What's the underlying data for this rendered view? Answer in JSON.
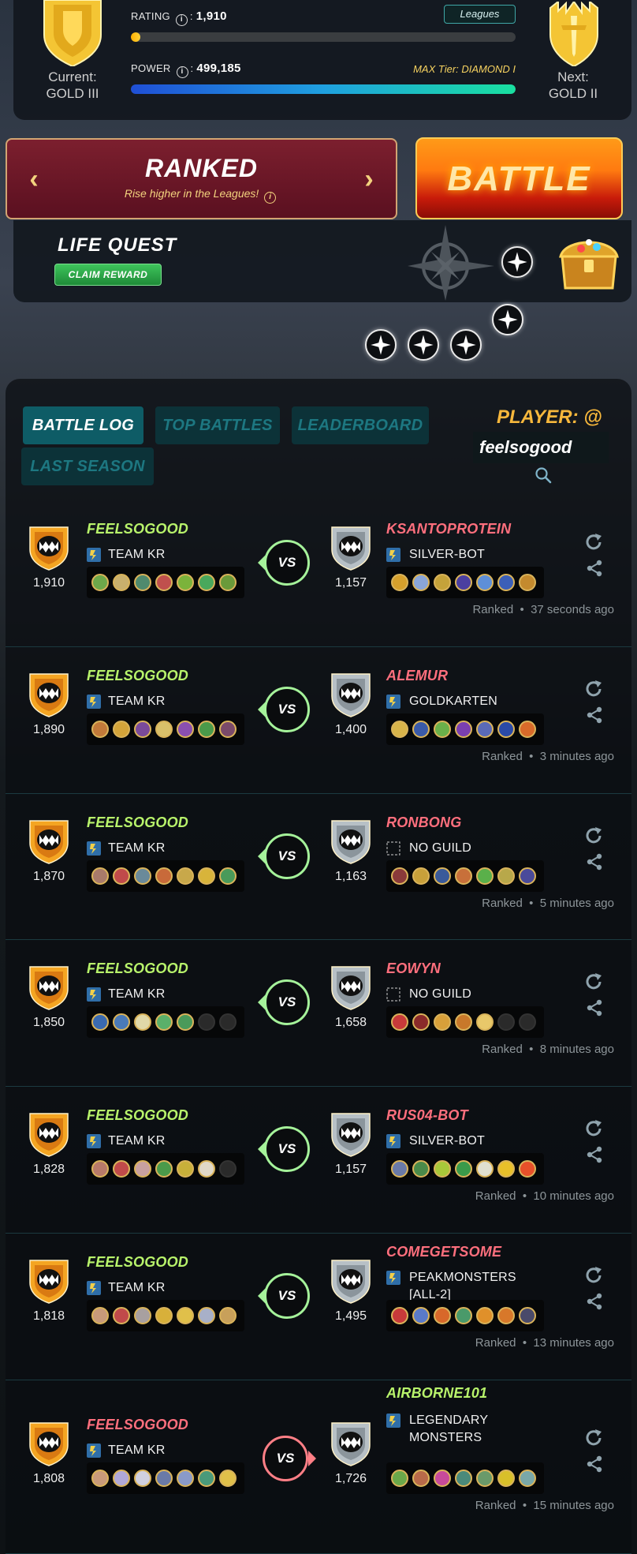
{
  "league": {
    "current_label": "Current:",
    "current_tier": "GOLD III",
    "next_label": "Next:",
    "next_tier": "GOLD II",
    "rating_label": "RATING",
    "rating_value": "1,910",
    "rating_progress": 0.025,
    "power_label": "POWER",
    "power_value": "499,185",
    "power_progress": 1.0,
    "leagues_button": "Leagues",
    "max_tier": "MAX Tier: DIAMOND I",
    "colors": {
      "gold": "#f4c534",
      "rating_bar": "#ffb000",
      "power_bar_start": "#1f4fd6",
      "power_bar_end": "#19e0a0"
    }
  },
  "ranked": {
    "title": "RANKED",
    "subtitle": "Rise higher in the Leagues!",
    "prev_icon": "chevron-left-icon",
    "next_icon": "chevron-right-icon"
  },
  "battle_button": "BATTLE",
  "quest": {
    "title": "LIFE QUEST",
    "claim_button": "CLAIM REWARD"
  },
  "tabs": [
    {
      "label": "BATTLE LOG",
      "active": true
    },
    {
      "label": "TOP BATTLES",
      "active": false
    },
    {
      "label": "LEADERBOARD",
      "active": false
    },
    {
      "label": "LAST SEASON",
      "active": false
    }
  ],
  "player": {
    "label": "PLAYER: @",
    "value": "feelsogood"
  },
  "colors": {
    "win_name": "#b8f36b",
    "loss_name": "#ff6f7d",
    "vs_win": "#a5f29a",
    "vs_loss": "#ff7f86"
  },
  "battles": [
    {
      "left": {
        "name": "FEELSOGOOD",
        "guild": "TEAM KR",
        "rating": "1,910",
        "won": true
      },
      "right": {
        "name": "KSANTOPROTEIN",
        "guild": "SILVER-BOT",
        "rating": "1,157",
        "won": false
      },
      "mode": "Ranked",
      "time": "37 seconds ago",
      "left_units": [
        "#6da84a",
        "#c9b06d",
        "#4f8a6e",
        "#c0504d",
        "#7bb33b",
        "#49a85c",
        "#6a9a3a"
      ],
      "right_units": [
        "#d6a02c",
        "#8aa6d8",
        "#c5a23a",
        "#4b3fa0",
        "#5e8fd8",
        "#3b5fb8",
        "#c48a2e"
      ]
    },
    {
      "left": {
        "name": "FEELSOGOOD",
        "guild": "TEAM KR",
        "rating": "1,890",
        "won": true
      },
      "right": {
        "name": "ALEMUR",
        "guild": "GOLDKARTEN",
        "rating": "1,400",
        "won": false
      },
      "mode": "Ranked",
      "time": "3 minutes ago",
      "left_units": [
        "#c27a3a",
        "#d4a43a",
        "#7a4a9a",
        "#d9c06a",
        "#8a4fb0",
        "#4a9a4a",
        "#7a4a6a"
      ],
      "right_units": [
        "#d8b44a",
        "#3a5aa8",
        "#6ab04a",
        "#7a3fb0",
        "#5a6ab8",
        "#2a4aa8",
        "#d86a2a"
      ]
    },
    {
      "left": {
        "name": "FEELSOGOOD",
        "guild": "TEAM KR",
        "rating": "1,870",
        "won": true
      },
      "right": {
        "name": "RONBONG",
        "guild": "NO GUILD",
        "rating": "1,163",
        "won": false
      },
      "mode": "Ranked",
      "time": "5 minutes ago",
      "left_units": [
        "#a87a6a",
        "#c04a4a",
        "#6a8a9a",
        "#c86a3a",
        "#c8a84a",
        "#d8b43a",
        "#4a9a5a"
      ],
      "right_units": [
        "#8a3a3a",
        "#c8a03a",
        "#3a5a9a",
        "#c8703a",
        "#5ab04a",
        "#b8a84a",
        "#4a4a9a"
      ]
    },
    {
      "left": {
        "name": "FEELSOGOOD",
        "guild": "TEAM KR",
        "rating": "1,850",
        "won": true
      },
      "right": {
        "name": "EOWYN",
        "guild": "NO GUILD",
        "rating": "1,658",
        "won": false
      },
      "mode": "Ranked",
      "time": "8 minutes ago",
      "left_units": [
        "#3a6ab0",
        "#4a7ab8",
        "#e0d8a8",
        "#5ab06a",
        "#4a9a5a",
        "",
        ""
      ],
      "right_units": [
        "#c83a3a",
        "#8a2a2a",
        "#d8a03a",
        "#c8782a",
        "#e8c86a",
        "",
        ""
      ]
    },
    {
      "left": {
        "name": "FEELSOGOOD",
        "guild": "TEAM KR",
        "rating": "1,828",
        "won": true
      },
      "right": {
        "name": "RUS04-BOT",
        "guild": "SILVER-BOT",
        "rating": "1,157",
        "won": false
      },
      "mode": "Ranked",
      "time": "10 minutes ago",
      "left_units": [
        "#b87a6a",
        "#c04a4a",
        "#c8a0a0",
        "#4a9a4a",
        "#c8b03a",
        "#e0d8c8",
        ""
      ],
      "right_units": [
        "#6a7aa8",
        "#4a8a4a",
        "#a8c83a",
        "#3a9a4a",
        "#e0e0d0",
        "#e8c02a",
        "#e8502a"
      ]
    },
    {
      "left": {
        "name": "FEELSOGOOD",
        "guild": "TEAM KR",
        "rating": "1,818",
        "won": true
      },
      "right": {
        "name": "COMEGETSOME",
        "guild": "PEAKMONSTERS [ALL-2]",
        "rating": "1,495",
        "won": false
      },
      "mode": "Ranked",
      "time": "13 minutes ago",
      "left_units": [
        "#c89a7a",
        "#c04a4a",
        "#a8a0a0",
        "#d8b03a",
        "#e0c04a",
        "#a8b0c8",
        "#c8a05a"
      ],
      "right_units": [
        "#c83a3a",
        "#5a7ac8",
        "#d8682a",
        "#4a9a6a",
        "#e0902a",
        "#d8782a",
        "#4a4a6a"
      ]
    },
    {
      "left": {
        "name": "FEELSOGOOD",
        "guild": "TEAM KR",
        "rating": "1,808",
        "won": false
      },
      "right": {
        "name": "AIRBORNE101",
        "guild": "LEGENDARY MONSTERS",
        "rating": "1,726",
        "won": true
      },
      "mode": "Ranked",
      "time": "15 minutes ago",
      "left_units": [
        "#c89a7a",
        "#b0a8d8",
        "#d0d0e0",
        "#6a7aa8",
        "#8a9ac8",
        "#4a9a7a",
        "#e0c04a"
      ],
      "right_units": [
        "#6aa84a",
        "#b86a4a",
        "#c84a9a",
        "#4a8a7a",
        "#6a9a6a",
        "#d8c02a",
        "#7aa8a8"
      ]
    }
  ]
}
